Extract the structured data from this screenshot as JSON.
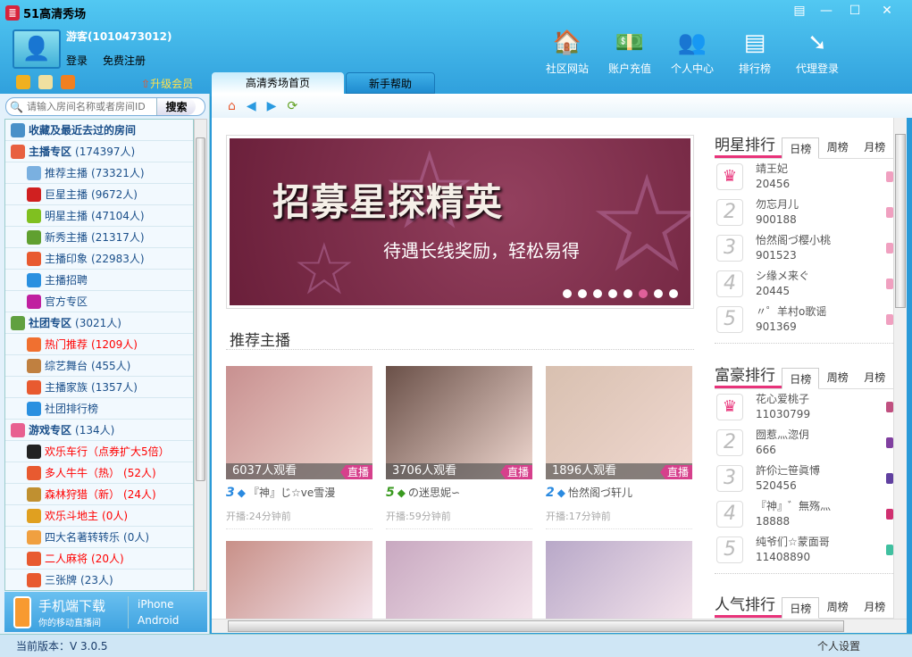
{
  "app": {
    "title": "51高清秀场",
    "window_controls": [
      "menu",
      "minimize",
      "maximize",
      "close"
    ]
  },
  "user": {
    "name": "游客(1010473012)",
    "login": "登录",
    "register": "免费注册",
    "upgrade": "升级会员"
  },
  "search": {
    "placeholder": "请输入房间名称或者房间ID",
    "button": "搜索"
  },
  "top_nav": [
    {
      "label": "社区网站",
      "icon": "house-icon"
    },
    {
      "label": "账户充值",
      "icon": "money-icon"
    },
    {
      "label": "个人中心",
      "icon": "users-icon"
    },
    {
      "label": "排行榜",
      "icon": "ranking-icon"
    },
    {
      "label": "代理登录",
      "icon": "arrow-icon"
    }
  ],
  "tabs": [
    {
      "label": "高清秀场首页",
      "active": true
    },
    {
      "label": "新手帮助",
      "active": false
    }
  ],
  "tree": [
    {
      "label": "收藏及最近去过的房间",
      "count": "",
      "type": "cat",
      "color": "#4a90c8"
    },
    {
      "label": "主播专区",
      "count": "(174397人)",
      "type": "cat",
      "color": "#e86040"
    },
    {
      "label": "推荐主播",
      "count": "(73321人)",
      "type": "sub",
      "color": "#7ab0e0"
    },
    {
      "label": "巨星主播",
      "count": "(9672人)",
      "type": "sub",
      "color": "#d02020"
    },
    {
      "label": "明星主播",
      "count": "(47104人)",
      "type": "sub",
      "color": "#80c020"
    },
    {
      "label": "新秀主播",
      "count": "(21317人)",
      "type": "sub",
      "color": "#60a030"
    },
    {
      "label": "主播印象",
      "count": "(22983人)",
      "type": "sub",
      "color": "#e85a30"
    },
    {
      "label": "主播招聘",
      "count": "",
      "type": "sub",
      "color": "#2a90e0"
    },
    {
      "label": "官方专区",
      "count": "",
      "type": "sub",
      "color": "#c020a0"
    },
    {
      "label": "社团专区",
      "count": "(3021人)",
      "type": "cat",
      "color": "#60a040"
    },
    {
      "label": "热门推荐",
      "count": "(1209人)",
      "type": "sub red",
      "color": "#f07030"
    },
    {
      "label": "综艺舞台",
      "count": "(455人)",
      "type": "sub",
      "color": "#c08040"
    },
    {
      "label": "主播家族",
      "count": "(1357人)",
      "type": "sub",
      "color": "#e85a30"
    },
    {
      "label": "社团排行榜",
      "count": "",
      "type": "sub",
      "color": "#2a90e0"
    },
    {
      "label": "游戏专区",
      "count": "(134人)",
      "type": "cat",
      "color": "#e86090"
    },
    {
      "label": "欢乐车行（点券扩大5倍）",
      "count": "",
      "type": "sub red",
      "color": "#222"
    },
    {
      "label": "多人牛牛（热）",
      "count": "(52人)",
      "type": "sub red",
      "color": "#e85a30"
    },
    {
      "label": "森林狩猎（新）",
      "count": "(24人)",
      "type": "sub red",
      "color": "#c09030"
    },
    {
      "label": "欢乐斗地主",
      "count": "(0人)",
      "type": "sub red",
      "color": "#e0a020"
    },
    {
      "label": "四大名著转转乐",
      "count": "(0人)",
      "type": "sub",
      "color": "#f0a040"
    },
    {
      "label": "二人麻将",
      "count": "(20人)",
      "type": "sub red",
      "color": "#e85a30"
    },
    {
      "label": "三张牌",
      "count": "(23人)",
      "type": "sub",
      "color": "#e85a30"
    }
  ],
  "mobile": {
    "title": "手机端下载",
    "subtitle": "你的移动直播间",
    "ios": "iPhone",
    "android": "Android"
  },
  "status": {
    "version": "当前版本：V 3.0.5",
    "settings": "个人设置"
  },
  "banner": {
    "title": "招募星探精英",
    "subtitle": "待遇长线奖励，轻松易得",
    "slides": 8,
    "active_slide": 6
  },
  "recommended": {
    "title": "推荐主播",
    "cards": [
      {
        "viewers": "6037人观看",
        "live": "直播",
        "level": "3",
        "name": "『神』じ☆ve雪漫",
        "time": "开播:24分钟前",
        "bg": "#c89090",
        "lvcolor": "#2a8ae0"
      },
      {
        "viewers": "3706人观看",
        "live": "直播",
        "level": "5",
        "name": "の迷思妮∽",
        "time": "开播:59分钟前",
        "bg": "#6a5048",
        "lvcolor": "#3a9a20"
      },
      {
        "viewers": "1896人观看",
        "live": "直播",
        "level": "2",
        "name": "怡然阁づ轩儿",
        "time": "开播:17分钟前",
        "bg": "#d8c0b0",
        "lvcolor": "#2a8ae0"
      }
    ],
    "row2_bg": [
      "#c89088",
      "#c8a8c0",
      "#b8a8c8"
    ]
  },
  "rankings": [
    {
      "title": "明星排行",
      "tabs": [
        "日榜",
        "周榜",
        "月榜"
      ],
      "items": [
        {
          "name": "靖王妃",
          "value": "20456"
        },
        {
          "name": "勿忘月儿",
          "value": "900188"
        },
        {
          "name": "怡然阁づ樱小桃",
          "value": "901523"
        },
        {
          "name": "シ缘メ来ぐ",
          "value": "20445"
        },
        {
          "name": "〃゜羊村o歌谣",
          "value": "901369"
        }
      ]
    },
    {
      "title": "富豪排行",
      "tabs": [
        "日榜",
        "周榜",
        "月榜"
      ],
      "items": [
        {
          "name": "花心爱桃子",
          "value": "11030799"
        },
        {
          "name": "囫惹灬淴仴",
          "value": "666"
        },
        {
          "name": "許伱辷笹眞愽",
          "value": "520456"
        },
        {
          "name": "『神』゛無殇灬",
          "value": "18888"
        },
        {
          "name": "纯爷们☆蒙面哥",
          "value": "11408890"
        }
      ]
    },
    {
      "title": "人气排行",
      "tabs": [
        "日榜",
        "周榜",
        "月榜"
      ],
      "items": []
    }
  ],
  "colors": {
    "accent": "#e8337a",
    "header": "#3aaee6",
    "live": "#d6408c"
  }
}
